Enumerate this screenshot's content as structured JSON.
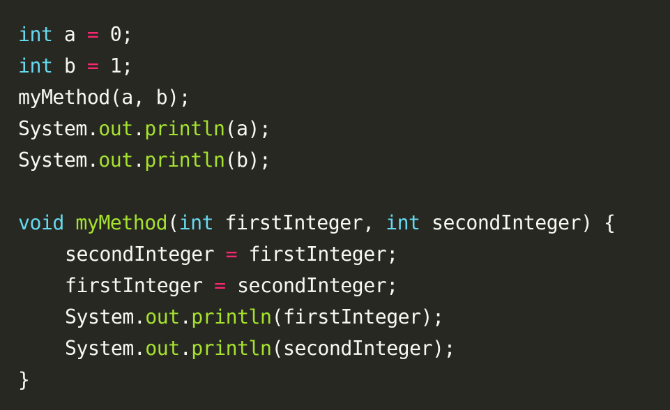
{
  "code": {
    "line1": [
      "int",
      " a ",
      "=",
      " 0;"
    ],
    "line2": [
      "int",
      " b ",
      "=",
      " 1;"
    ],
    "line3": [
      "myMethod(a, b);"
    ],
    "line4": [
      "System.",
      "out",
      ".",
      "println",
      "(a);"
    ],
    "line5": [
      "System.",
      "out",
      ".",
      "println",
      "(b);"
    ],
    "line7": [
      "void",
      " ",
      "myMethod",
      "(",
      "int",
      " firstInteger, ",
      "int",
      " secondInteger) {"
    ],
    "line8": [
      "secondInteger ",
      "=",
      " firstInteger;"
    ],
    "line9": [
      "firstInteger ",
      "=",
      " secondInteger;"
    ],
    "line10": [
      "System.",
      "out",
      ".",
      "println",
      "(firstInteger);"
    ],
    "line11": [
      "System.",
      "out",
      ".",
      "println",
      "(secondInteger);"
    ],
    "line12": [
      "}"
    ]
  },
  "colors": {
    "background": "#272822",
    "keyword_type": "#66d9ef",
    "operator": "#f92672",
    "function": "#a6e22e",
    "plain": "#f8f8f2"
  }
}
